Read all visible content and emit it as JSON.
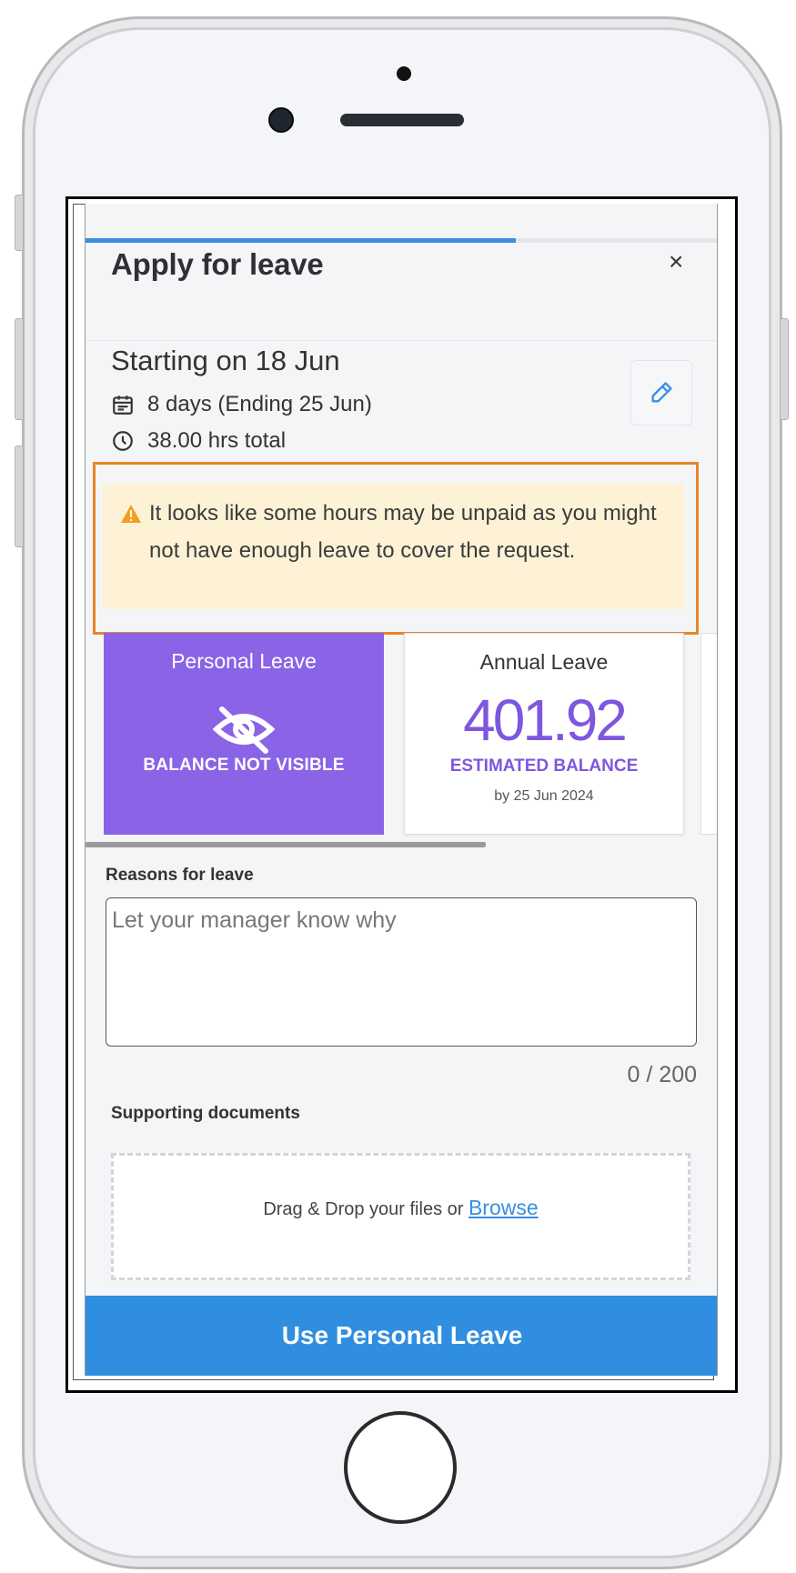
{
  "header": {
    "title": "Apply for leave",
    "close_label": "×",
    "progress_percent": 68
  },
  "summary": {
    "starting": "Starting on 18 Jun",
    "days": "8 days (Ending 25 Jun)",
    "hours": "38.00 hrs total"
  },
  "warning": {
    "text": "It looks like some hours may be unpaid as you might not have enough leave to cover the request."
  },
  "leave_types": [
    {
      "title": "Personal Leave",
      "status": "BALANCE NOT VISIBLE",
      "selected": true
    },
    {
      "title": "Annual Leave",
      "value": "401.92",
      "label": "ESTIMATED BALANCE",
      "date": "by 25 Jun 2024",
      "selected": false
    }
  ],
  "reasons": {
    "label": "Reasons for leave",
    "placeholder": "Let your manager know why",
    "counter": "0 / 200"
  },
  "documents": {
    "label": "Supporting documents",
    "drop_text": "Drag & Drop your files or ",
    "browse_label": "Browse"
  },
  "submit": {
    "label": "Use Personal Leave"
  },
  "colors": {
    "primary": "#2f8ee0",
    "accent_purple": "#8a63e6",
    "warning_bg": "#fdf2d6",
    "highlight_border": "#e8862a"
  },
  "icons": {
    "close": "close-icon",
    "calendar": "calendar-icon",
    "clock": "clock-icon",
    "edit": "pencil-icon",
    "warning": "warning-icon",
    "hidden": "eye-off-icon"
  }
}
